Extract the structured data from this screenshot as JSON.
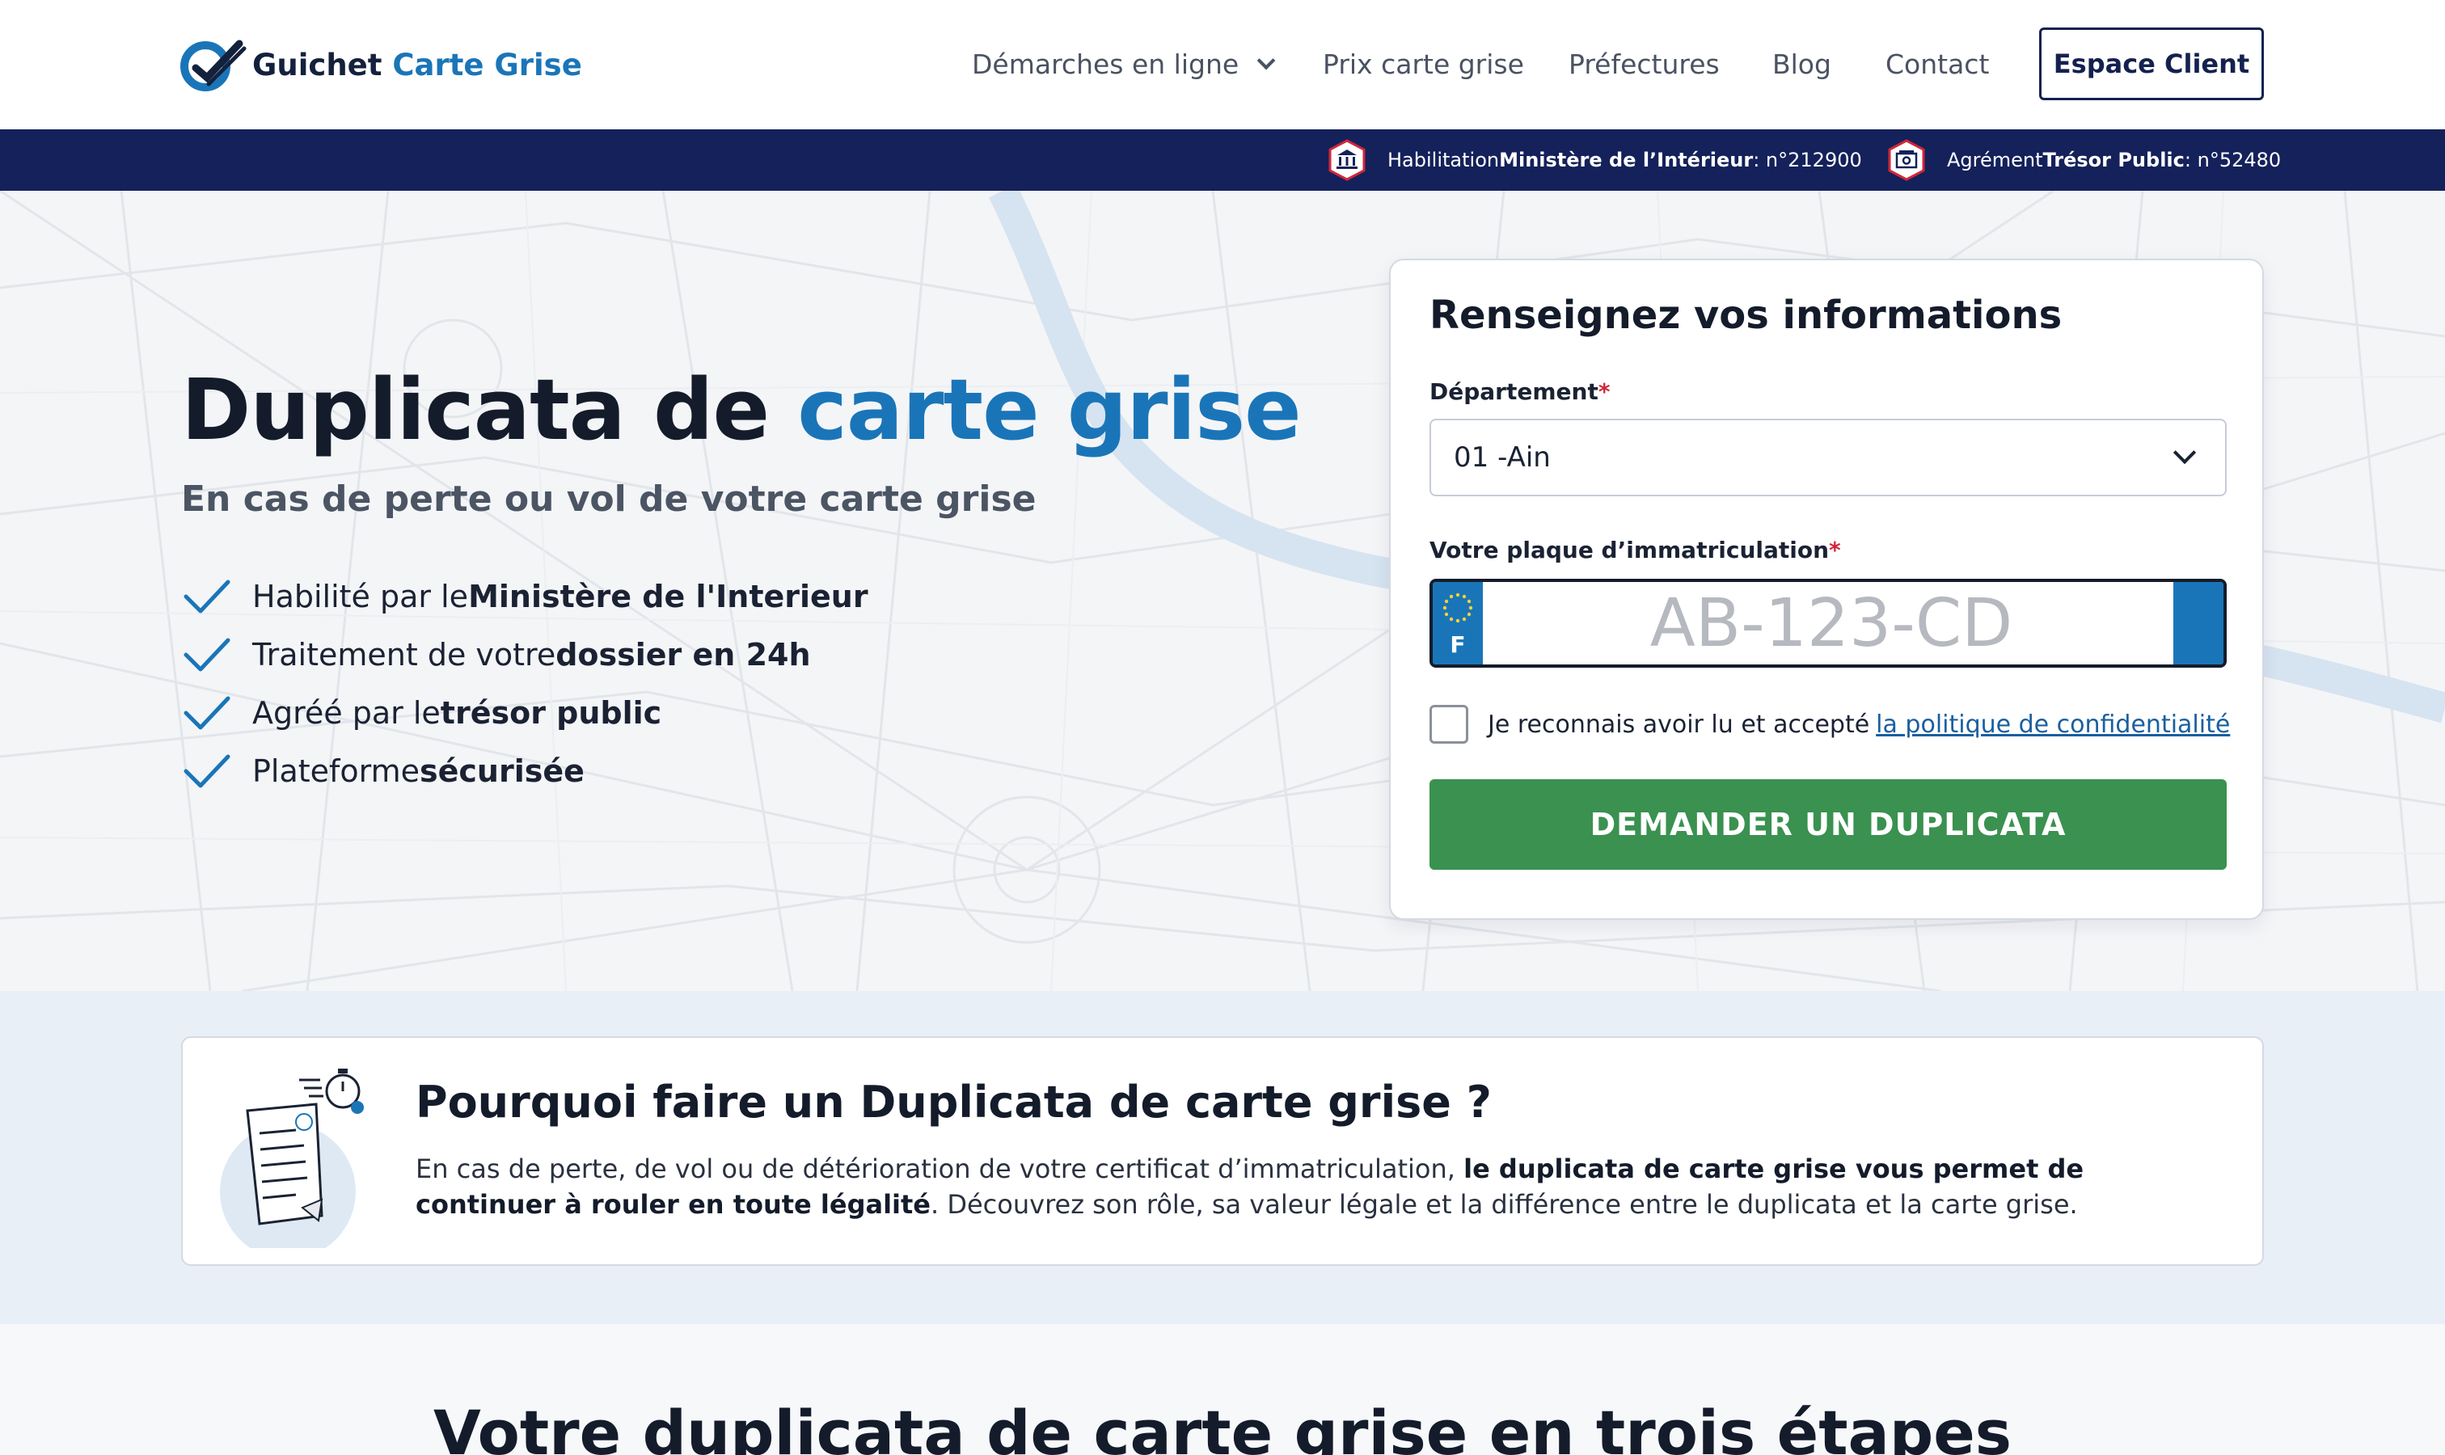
{
  "brand": {
    "name_part1": "Guichet ",
    "name_part2": "Carte Grise"
  },
  "nav": {
    "items": [
      {
        "label": "Démarches en ligne"
      },
      {
        "label": "Prix carte grise"
      },
      {
        "label": "Préfectures"
      },
      {
        "label": "Blog"
      },
      {
        "label": "Contact"
      }
    ],
    "espace_client": "Espace Client"
  },
  "band": {
    "habilitation": {
      "prefix": "Habilitation ",
      "bold": "Ministère de l’Intérieur",
      "suffix": " : n°212900"
    },
    "agrement": {
      "prefix": "Agrément ",
      "bold": "Trésor Public",
      "suffix": " : n°52480"
    }
  },
  "hero": {
    "title_part1": "Duplicata de ",
    "title_part2": "carte grise",
    "subtitle": "En cas de perte ou vol de votre carte grise",
    "features": [
      {
        "text": "Habilité par le ",
        "bold": "Ministère de l'Interieur"
      },
      {
        "text": "Traitement de votre ",
        "bold": "dossier en 24h"
      },
      {
        "text": "Agréé par le ",
        "bold": "trésor public"
      },
      {
        "text": "Plateforme ",
        "bold": "sécurisée"
      }
    ]
  },
  "form": {
    "title": "Renseignez vos informations",
    "department_label": "Département",
    "required_mark": "*",
    "department_value": "01 -Ain",
    "plate_label": "Votre plaque d’immatriculation",
    "plate_placeholder": "AB-123-CD",
    "plate_country": "F",
    "consent_text": "Je reconnais avoir lu et accepté",
    "consent_link": "la politique de confidentialité",
    "submit": "DEMANDER UN DUPLICATA"
  },
  "why": {
    "title": "Pourquoi faire un Duplicata de carte grise ?",
    "text_part1": "En cas de perte, de vol ou de détérioration de votre certificat d’immatriculation, ",
    "text_bold": "le duplicata de carte grise vous permet de continuer à rouler en toute légalité",
    "text_part2": ". Découvrez son rôle, sa valeur légale et la différence entre le duplicata et la carte grise."
  },
  "steps": {
    "title": "Votre duplicata de carte grise en trois étapes"
  },
  "colors": {
    "accent": "#1a75b8",
    "navy": "#14215a",
    "cta_green": "#3a9150",
    "required": "#d0263b"
  }
}
